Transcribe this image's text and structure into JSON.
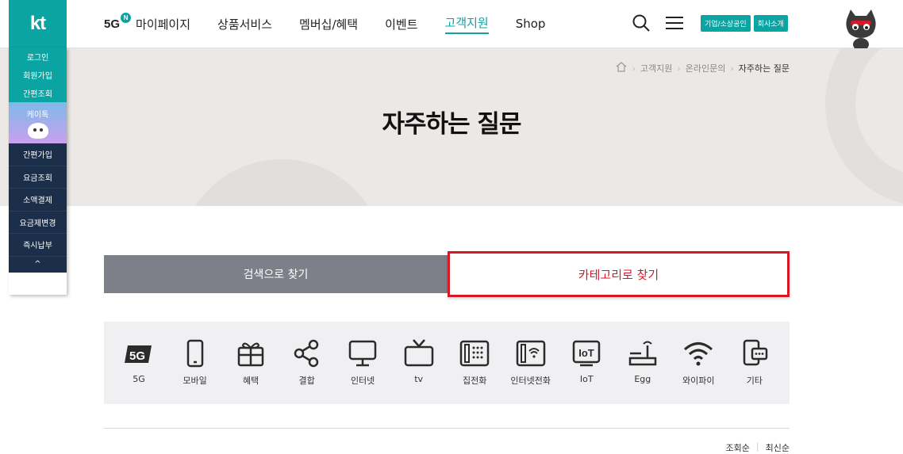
{
  "header": {
    "logo": "kt",
    "nav": {
      "fiveg": "5G",
      "fiveg_badge": "N",
      "items": [
        "마이페이지",
        "상품서비스",
        "멤버십/혜택",
        "이벤트",
        "고객지원",
        "Shop"
      ],
      "active_index": 4
    },
    "pills": [
      "기업/소상공인",
      "회사소개"
    ],
    "accent_color": "#0aa4a3"
  },
  "quick_menu": {
    "top": [
      "로그인",
      "회원가입",
      "간편조회"
    ],
    "kai": "케이톡",
    "bottom": [
      "간편가입",
      "요금조회",
      "소액결제",
      "요금제변경",
      "즉시납부"
    ],
    "up": "^"
  },
  "breadcrumb": {
    "items": [
      "고객지원",
      "온라인문의"
    ],
    "current": "자주하는 질문"
  },
  "page_title": "자주하는 질문",
  "tabs": {
    "search": "검색으로 찾기",
    "category": "카테고리로 찾기"
  },
  "categories": [
    {
      "label": "5G",
      "icon": "5g-icon"
    },
    {
      "label": "모바일",
      "icon": "mobile-icon"
    },
    {
      "label": "혜택",
      "icon": "gift-icon"
    },
    {
      "label": "결합",
      "icon": "share-icon"
    },
    {
      "label": "인터넷",
      "icon": "monitor-icon"
    },
    {
      "label": "tv",
      "icon": "tv-icon"
    },
    {
      "label": "집전화",
      "icon": "home-phone-icon"
    },
    {
      "label": "인터넷전화",
      "icon": "voip-phone-icon"
    },
    {
      "label": "IoT",
      "icon": "iot-icon"
    },
    {
      "label": "Egg",
      "icon": "egg-router-icon"
    },
    {
      "label": "와이파이",
      "icon": "wifi-icon"
    },
    {
      "label": "기타",
      "icon": "etc-icon"
    }
  ],
  "sort": [
    "조회순",
    "최신순"
  ]
}
